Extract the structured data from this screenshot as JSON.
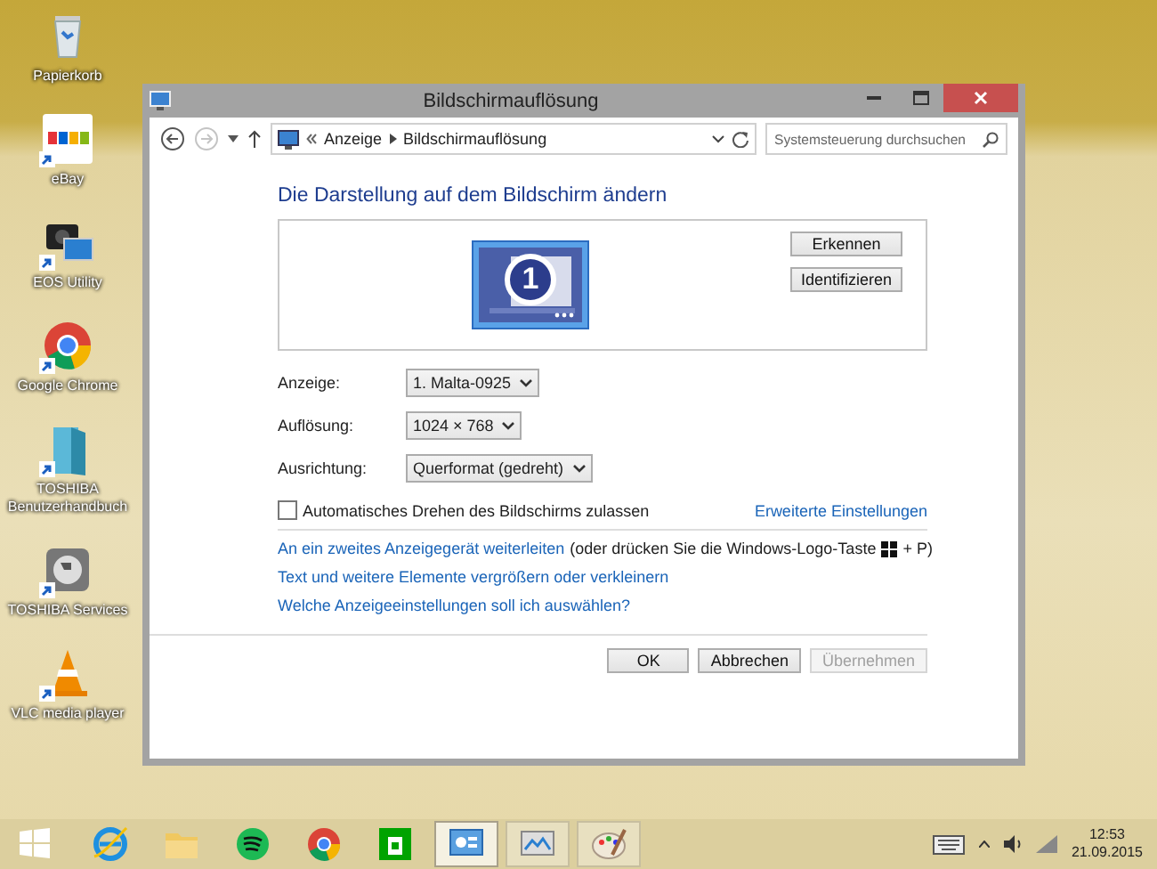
{
  "desktop": {
    "icons": [
      {
        "label": "Papierkorb",
        "shortcut": false
      },
      {
        "label": "eBay",
        "shortcut": true
      },
      {
        "label": "EOS Utility",
        "shortcut": true
      },
      {
        "label": "Google Chrome",
        "shortcut": true
      },
      {
        "label": "TOSHIBA Benutzerhandbuch",
        "shortcut": true
      },
      {
        "label": "TOSHIBA Services",
        "shortcut": true
      },
      {
        "label": "VLC media player",
        "shortcut": true
      }
    ]
  },
  "window": {
    "title": "Bildschirmauflösung",
    "nav": {
      "forward_disabled": true
    },
    "address": {
      "crumbs": [
        "Anzeige",
        "Bildschirmauflösung"
      ]
    },
    "search": {
      "placeholder": "Systemsteuerung durchsuchen"
    },
    "heading": "Die Darstellung auf dem Bildschirm ändern",
    "preview": {
      "monitor_number": "1",
      "buttons": [
        "Erkennen",
        "Identifizieren"
      ]
    },
    "settings": [
      {
        "label": "Anzeige:",
        "value": "1. Malta-0925"
      },
      {
        "label": "Auflösung:",
        "value": "1024 × 768"
      },
      {
        "label": "Ausrichtung:",
        "value": "Querformat (gedreht)"
      }
    ],
    "auto_rotate": {
      "label": "Automatisches Drehen des Bildschirms zulassen",
      "checked": false
    },
    "advanced_link": "Erweiterte Einstellungen",
    "project": {
      "link": "An ein zweites Anzeigegerät weiterleiten",
      "hint": "(oder drücken Sie die Windows-Logo-Taste",
      "hint_end": "+ P)"
    },
    "links": [
      "Text und weitere Elemente vergrößern oder verkleinern",
      "Welche Anzeigeeinstellungen soll ich auswählen?"
    ],
    "buttons": [
      {
        "label": "OK",
        "disabled": false
      },
      {
        "label": "Abbrechen",
        "disabled": false
      },
      {
        "label": "Übernehmen",
        "disabled": true
      }
    ]
  },
  "taskbar": {
    "apps": [
      {
        "running": false,
        "selected": false
      },
      {
        "running": false,
        "selected": false
      },
      {
        "running": false,
        "selected": false
      },
      {
        "running": false,
        "selected": false
      },
      {
        "running": false,
        "selected": false
      },
      {
        "running": false,
        "selected": false
      },
      {
        "running": true,
        "selected": true
      },
      {
        "running": true,
        "selected": false
      },
      {
        "running": true,
        "selected": false
      }
    ],
    "time": "12:53",
    "date": "21.09.2015"
  }
}
